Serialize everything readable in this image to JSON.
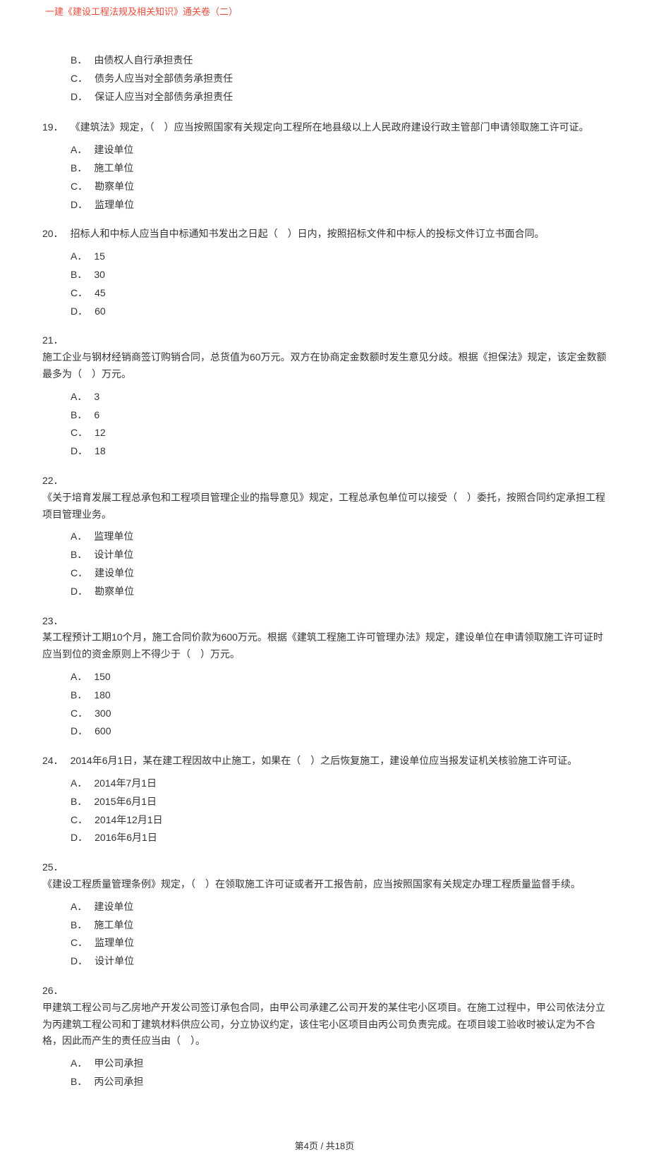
{
  "header": {
    "title": "一建《建设工程法规及相关知识》通关卷（二）"
  },
  "orphanOptions": [
    {
      "label": "B．",
      "text": "由债权人自行承担责任"
    },
    {
      "label": "C．",
      "text": "债务人应当对全部债务承担责任"
    },
    {
      "label": "D．",
      "text": "保证人应当对全部债务承担责任"
    }
  ],
  "questions": [
    {
      "num": "19．",
      "inline": true,
      "stem": "《建筑法》规定，（　）应当按照国家有关规定向工程所在地县级以上人民政府建设行政主管部门申请领取施工许可证。",
      "options": [
        {
          "label": "A．",
          "text": "建设单位"
        },
        {
          "label": "B．",
          "text": "施工单位"
        },
        {
          "label": "C．",
          "text": "勘察单位"
        },
        {
          "label": "D．",
          "text": "监理单位"
        }
      ]
    },
    {
      "num": "20．",
      "inline": true,
      "stem": "招标人和中标人应当自中标通知书发出之日起（　）日内，按照招标文件和中标人的投标文件订立书面合同。",
      "options": [
        {
          "label": "A．",
          "text": "15"
        },
        {
          "label": "B．",
          "text": "30"
        },
        {
          "label": "C．",
          "text": "45"
        },
        {
          "label": "D．",
          "text": "60"
        }
      ]
    },
    {
      "num": "21．",
      "inline": false,
      "stem": "施工企业与钢材经销商签订购销合同，总货值为60万元。双方在协商定金数额时发生意见分歧。根据《担保法》规定，该定金数额最多为（　）万元。",
      "options": [
        {
          "label": "A．",
          "text": "3"
        },
        {
          "label": "B．",
          "text": "6"
        },
        {
          "label": "C．",
          "text": "12"
        },
        {
          "label": "D．",
          "text": "18"
        }
      ]
    },
    {
      "num": "22．",
      "inline": false,
      "stem": "《关于培育发展工程总承包和工程项目管理企业的指导意见》规定，工程总承包单位可以接受（　）委托，按照合同约定承担工程项目管理业务。",
      "options": [
        {
          "label": "A．",
          "text": "监理单位"
        },
        {
          "label": "B．",
          "text": "设计单位"
        },
        {
          "label": "C．",
          "text": "建设单位"
        },
        {
          "label": "D．",
          "text": "勘察单位"
        }
      ]
    },
    {
      "num": "23．",
      "inline": false,
      "stem": "某工程预计工期10个月，施工合同价款为600万元。根据《建筑工程施工许可管理办法》规定，建设单位在申请领取施工许可证时应当到位的资金原则上不得少于（　）万元。",
      "options": [
        {
          "label": "A．",
          "text": "150"
        },
        {
          "label": "B．",
          "text": "180"
        },
        {
          "label": "C．",
          "text": "300"
        },
        {
          "label": "D．",
          "text": "600"
        }
      ]
    },
    {
      "num": "24．",
      "inline": true,
      "stem": "2014年6月1日，某在建工程因故中止施工，如果在（　）之后恢复施工，建设单位应当报发证机关核验施工许可证。",
      "options": [
        {
          "label": "A．",
          "text": "2014年7月1日"
        },
        {
          "label": "B．",
          "text": "2015年6月1日"
        },
        {
          "label": "C．",
          "text": "2014年12月1日"
        },
        {
          "label": "D．",
          "text": "2016年6月1日"
        }
      ]
    },
    {
      "num": "25．",
      "inline": false,
      "stem": "《建设工程质量管理条例》规定，（　）在领取施工许可证或者开工报告前，应当按照国家有关规定办理工程质量监督手续。",
      "options": [
        {
          "label": "A．",
          "text": "建设单位"
        },
        {
          "label": "B．",
          "text": "施工单位"
        },
        {
          "label": "C．",
          "text": "监理单位"
        },
        {
          "label": "D．",
          "text": "设计单位"
        }
      ]
    },
    {
      "num": "26．",
      "inline": false,
      "stem": "甲建筑工程公司与乙房地产开发公司签订承包合同，由甲公司承建乙公司开发的某住宅小区项目。在施工过程中，甲公司依法分立为丙建筑工程公司和丁建筑材料供应公司，分立协议约定，该住宅小区项目由丙公司负责完成。在项目竣工验收时被认定为不合格，因此而产生的责任应当由（　）。",
      "options": [
        {
          "label": "A．",
          "text": "甲公司承担"
        },
        {
          "label": "B．",
          "text": "丙公司承担"
        }
      ]
    }
  ],
  "footer": {
    "pageText": "第4页  /  共18页"
  }
}
